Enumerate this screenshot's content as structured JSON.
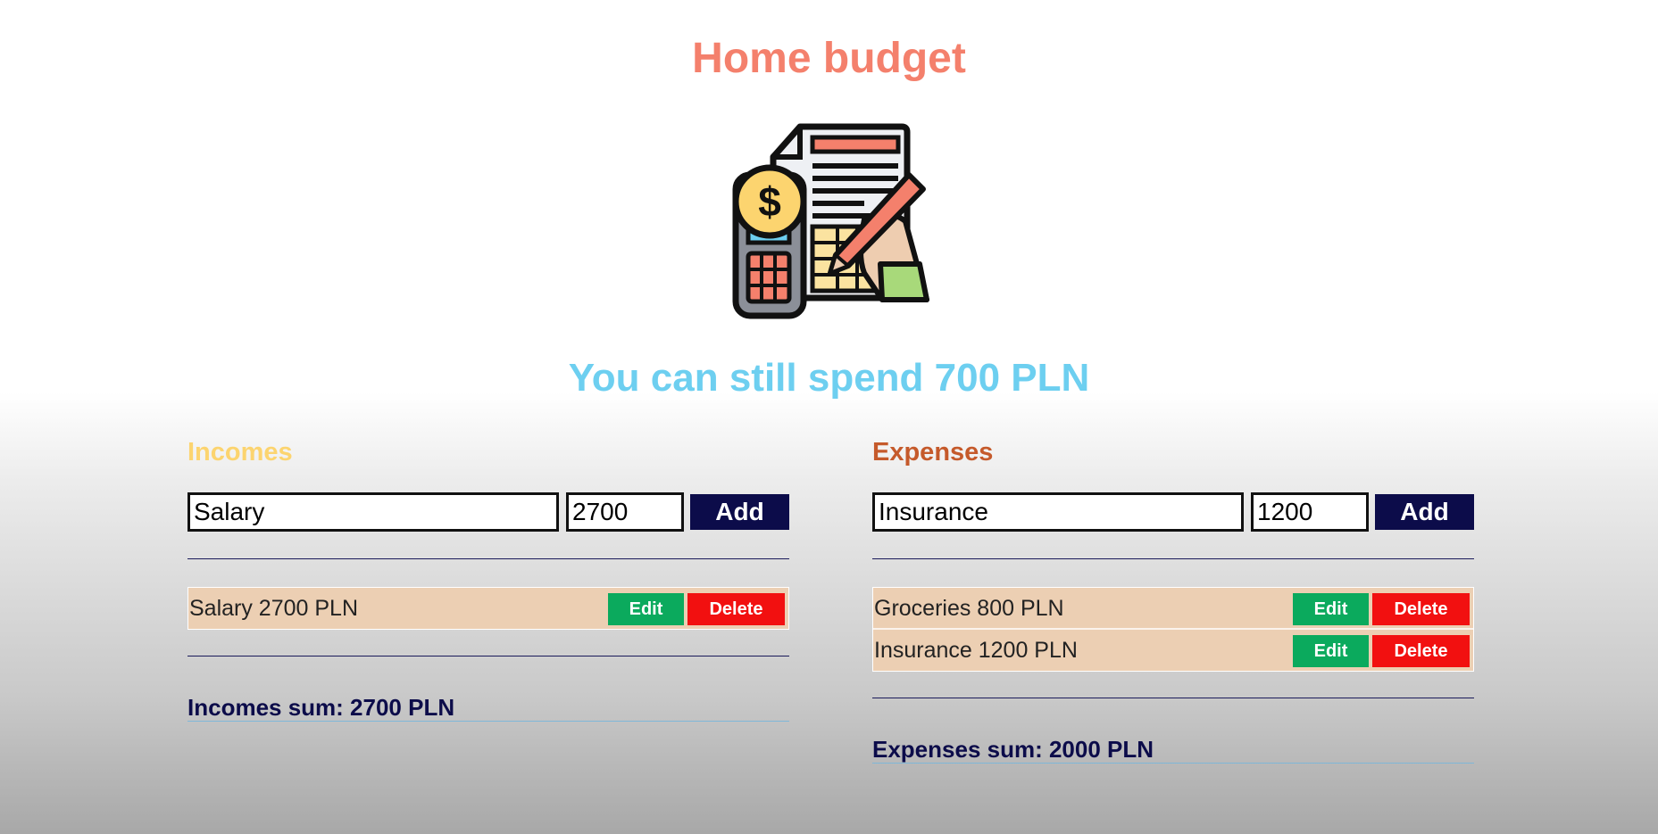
{
  "app": {
    "title": "Home budget",
    "balance": "You can still spend 700 PLN"
  },
  "incomes": {
    "heading": "Incomes",
    "form": {
      "name_value": "Salary",
      "amount_value": "2700",
      "add_label": "Add"
    },
    "items": [
      {
        "label": "Salary 2700 PLN",
        "edit": "Edit",
        "delete": "Delete"
      }
    ],
    "sum": "Incomes sum: 2700 PLN"
  },
  "expenses": {
    "heading": "Expenses",
    "form": {
      "name_value": "Insurance",
      "amount_value": "1200",
      "add_label": "Add"
    },
    "items": [
      {
        "label": "Groceries 800 PLN",
        "edit": "Edit",
        "delete": "Delete"
      },
      {
        "label": "Insurance 1200 PLN",
        "edit": "Edit",
        "delete": "Delete"
      }
    ],
    "sum": "Expenses sum: 2000 PLN"
  },
  "colors": {
    "title": "#f4806c",
    "balance": "#6dcff0",
    "incomes_heading": "#fcd46f",
    "expenses_heading": "#c55a2b",
    "add_button": "#0c0c4a",
    "edit_button": "#0baa5d",
    "delete_button": "#f21010",
    "item_background": "#eccfb3"
  },
  "icons": {
    "logo": "budget-calculator-invoice-icon"
  }
}
